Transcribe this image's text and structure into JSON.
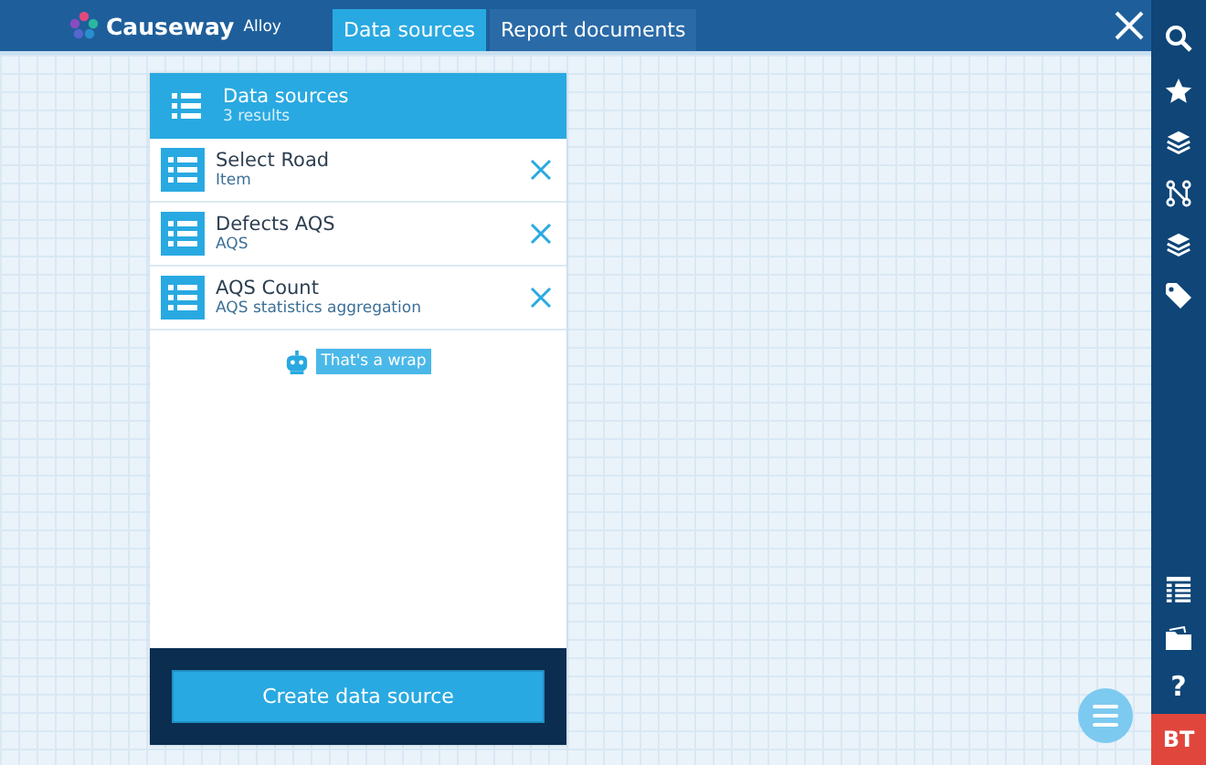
{
  "brand": {
    "name": "Causeway",
    "product": "Alloy"
  },
  "tabs": [
    {
      "label": "Data sources",
      "selected": true
    },
    {
      "label": "Report documents",
      "selected": false
    }
  ],
  "panel": {
    "title": "Data sources",
    "subtitle": "3 results",
    "items": [
      {
        "title": "Select Road",
        "subtitle": "Item"
      },
      {
        "title": "Defects AQS",
        "subtitle": "AQS"
      },
      {
        "title": "AQS Count",
        "subtitle": "AQS statistics aggregation"
      }
    ],
    "end_note": "That's a wrap",
    "create_button": "Create data source"
  },
  "sidebar": {
    "top": [
      {
        "kind": "search"
      },
      {
        "kind": "star"
      },
      {
        "kind": "layers"
      },
      {
        "kind": "nodes"
      },
      {
        "kind": "layers"
      },
      {
        "kind": "tag"
      }
    ],
    "bottom": [
      {
        "kind": "table"
      },
      {
        "kind": "folder"
      }
    ],
    "help": "?",
    "user": "BT"
  }
}
